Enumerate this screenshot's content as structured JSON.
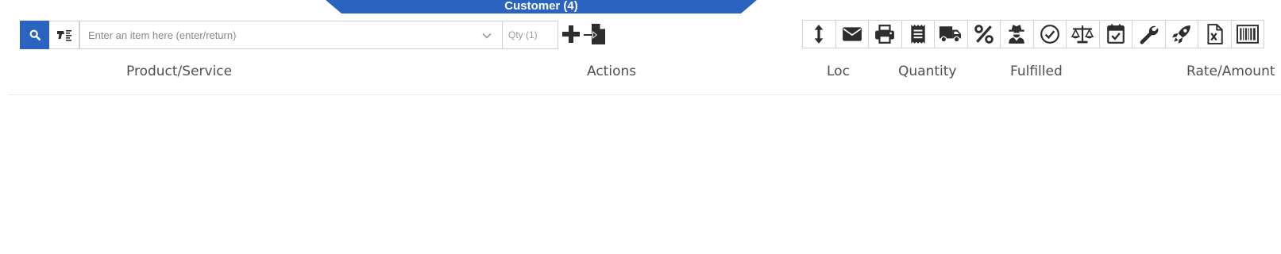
{
  "header": {
    "customer_tab": "Customer (4)"
  },
  "search": {
    "item_placeholder": "Enter an item here (enter/return)",
    "item_value": "",
    "qty_placeholder": "Qty (1)",
    "qty_value": ""
  },
  "toolbar": {
    "icons": [
      "resize-vertical-icon",
      "envelope-icon",
      "printer-icon",
      "receipt-icon",
      "truck-icon",
      "percent-icon",
      "user-secret-icon",
      "check-circle-icon",
      "balance-scale-icon",
      "calendar-check-icon",
      "wrench-icon",
      "rocket-icon",
      "excel-file-icon",
      "barcode-icon"
    ]
  },
  "columns": {
    "product": "Product/Service",
    "actions": "Actions",
    "loc": "Loc",
    "quantity": "Quantity",
    "fulfilled": "Fulfilled",
    "rate": "Rate/Amount"
  },
  "colors": {
    "accent": "#2a63c0",
    "icon": "#2d2d2d"
  }
}
